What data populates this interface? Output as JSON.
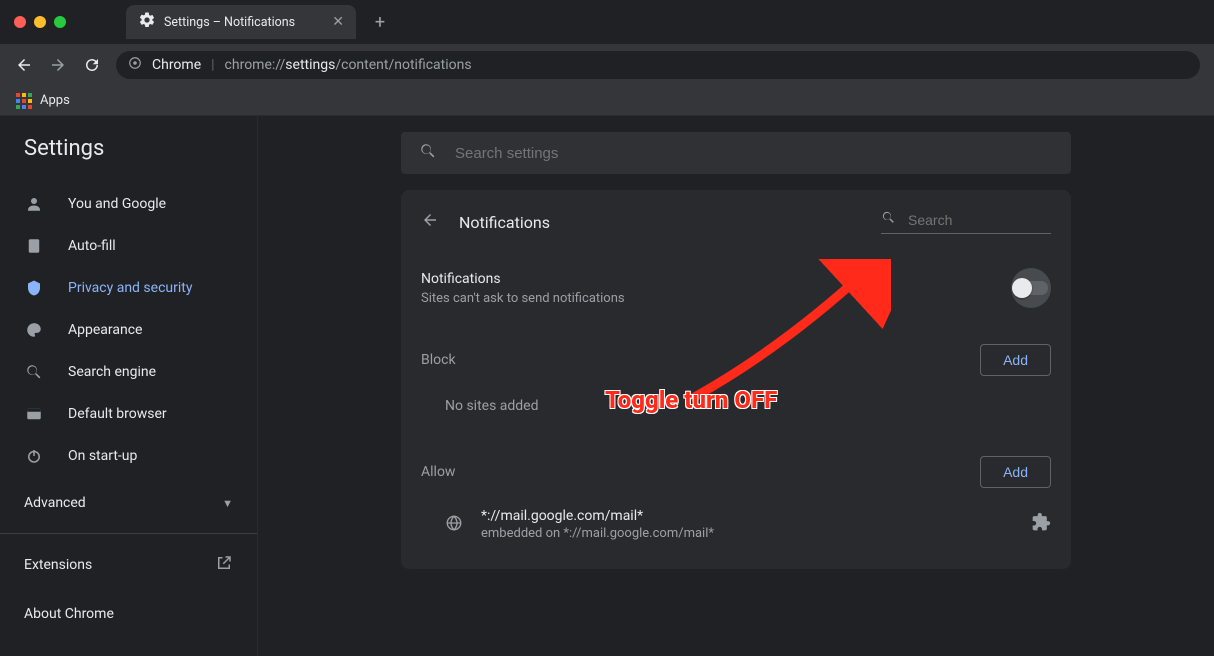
{
  "window": {
    "tab_title": "Settings – Notifications"
  },
  "urlbar": {
    "scheme": "Chrome",
    "path_prefix": "chrome://",
    "path_bold": "settings",
    "path_suffix": "/content/notifications"
  },
  "bookmarks": {
    "apps": "Apps"
  },
  "sidebar": {
    "title": "Settings",
    "items": [
      {
        "label": "You and Google"
      },
      {
        "label": "Auto-fill"
      },
      {
        "label": "Privacy and security"
      },
      {
        "label": "Appearance"
      },
      {
        "label": "Search engine"
      },
      {
        "label": "Default browser"
      },
      {
        "label": "On start-up"
      }
    ],
    "advanced": "Advanced",
    "extensions": "Extensions",
    "about": "About Chrome"
  },
  "search": {
    "placeholder": "Search settings"
  },
  "panel": {
    "title": "Notifications",
    "search_placeholder": "Search",
    "notifications_title": "Notifications",
    "notifications_sub": "Sites can't ask to send notifications",
    "toggle_on": false,
    "block_label": "Block",
    "allow_label": "Allow",
    "add_button": "Add",
    "no_sites": "No sites added",
    "allow_entry": {
      "site": "*://mail.google.com/mail*",
      "sub": "embedded on *://mail.google.com/mail*"
    }
  },
  "annotation": {
    "text": "Toggle turn OFF"
  }
}
